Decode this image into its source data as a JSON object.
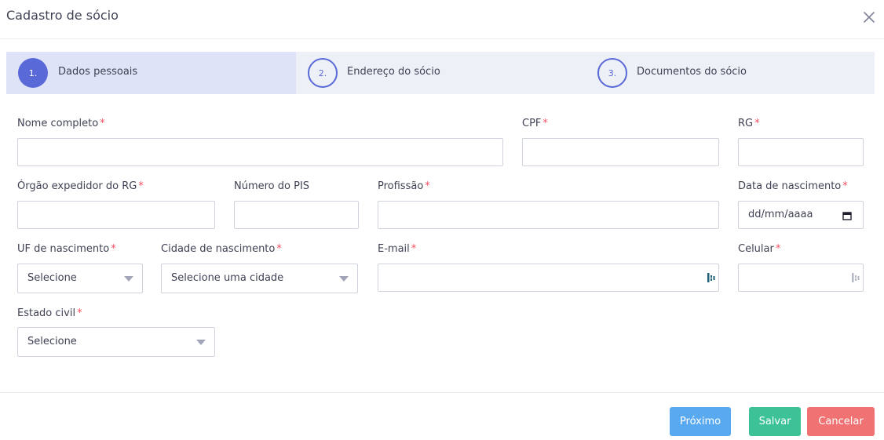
{
  "modal": {
    "title": "Cadastro de sócio"
  },
  "stepper": {
    "steps": [
      {
        "number": "1.",
        "label": "Dados pessoais",
        "state": "active"
      },
      {
        "number": "2.",
        "label": "Endereço do sócio",
        "state": "inactive"
      },
      {
        "number": "3.",
        "label": "Documentos do sócio",
        "state": "inactive"
      }
    ]
  },
  "form": {
    "required_marker": "*",
    "nome_completo": {
      "label": "Nome completo",
      "value": "",
      "required": true
    },
    "cpf": {
      "label": "CPF",
      "value": "",
      "required": true
    },
    "rg": {
      "label": "RG",
      "value": "",
      "required": true
    },
    "orgao_expedidor": {
      "label": "Órgão expedidor do RG",
      "value": "",
      "required": true
    },
    "numero_pis": {
      "label": "Número do PIS",
      "value": "",
      "required": false
    },
    "profissao": {
      "label": "Profissão",
      "value": "",
      "required": true
    },
    "data_nascimento": {
      "label": "Data de nascimento",
      "placeholder": "dd/mm/aaaa",
      "required": true
    },
    "uf_nascimento": {
      "label": "UF de nascimento",
      "selected": "Selecione",
      "required": true
    },
    "cidade_nascimento": {
      "label": "Cidade de nascimento",
      "selected": "Selecione uma cidade",
      "required": true
    },
    "email": {
      "label": "E-mail",
      "value": "",
      "required": true
    },
    "celular": {
      "label": "Celular",
      "value": "",
      "required": true
    },
    "estado_civil": {
      "label": "Estado civil",
      "selected": "Selecione",
      "required": true
    }
  },
  "footer": {
    "next_label": "Próximo",
    "save_label": "Salvar",
    "cancel_label": "Cancelar"
  },
  "colors": {
    "accent": "#5969d8",
    "required": "#f64e60",
    "next_button": "#58a9f0",
    "save_button": "#3cc296",
    "cancel_button": "#f07272",
    "stepper_bg": "#eef0f8",
    "stepper_active_bg": "#dfe3f7"
  },
  "icons": {
    "close": "close-icon",
    "calendar": "calendar-icon",
    "autofill_key": "password-manager-icon",
    "dropdown": "chevron-down-icon"
  }
}
